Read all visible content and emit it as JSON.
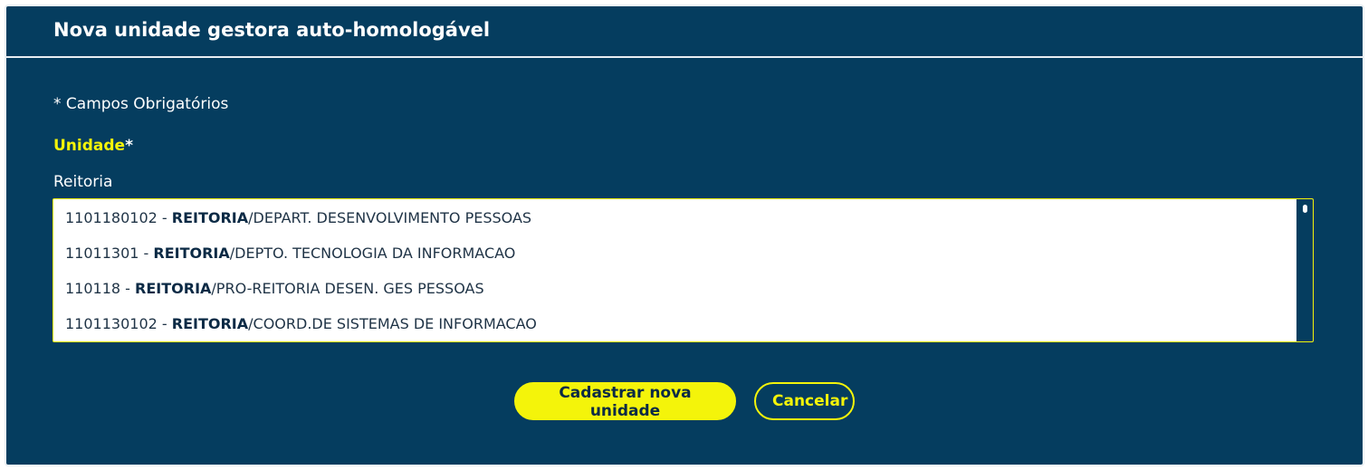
{
  "dialog": {
    "title": "Nova unidade gestora auto-homologável",
    "required_note": "* Campos Obrigatórios"
  },
  "field": {
    "label": "Unidade",
    "required_mark": "*",
    "search_value": "Reitoria"
  },
  "results": [
    {
      "code": "1101180102 - ",
      "match": "REITORIA",
      "rest": "/DEPART. DESENVOLVIMENTO PESSOAS"
    },
    {
      "code": "11011301 - ",
      "match": "REITORIA",
      "rest": "/DEPTO. TECNOLOGIA DA INFORMACAO"
    },
    {
      "code": "110118 - ",
      "match": "REITORIA",
      "rest": "/PRO-REITORIA DESEN. GES PESSOAS"
    },
    {
      "code": "1101130102 - ",
      "match": "REITORIA",
      "rest": "/COORD.DE SISTEMAS DE INFORMACAO"
    }
  ],
  "buttons": {
    "submit_label": "Cadastrar nova unidade",
    "cancel_label": "Cancelar"
  },
  "colors": {
    "background": "#053d5f",
    "accent": "#f4f40a",
    "text": "#ffffff"
  }
}
